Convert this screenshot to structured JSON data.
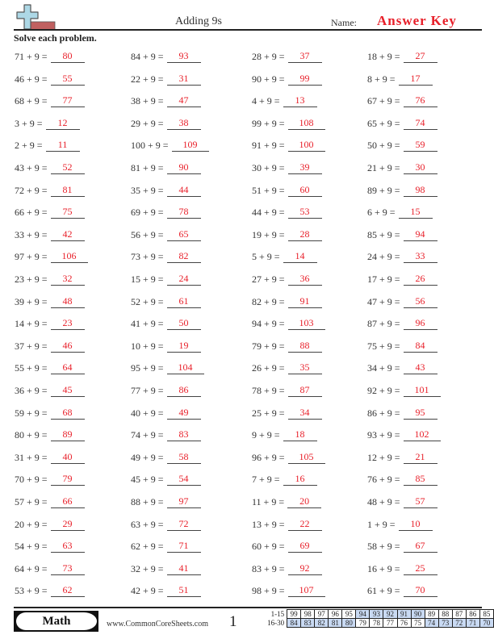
{
  "header": {
    "title": "Adding 9s",
    "name_label": "Name:",
    "name_value": "Answer Key"
  },
  "instructions": "Solve each problem.",
  "colors": {
    "answer": "#e8202a",
    "score_highlight": "#c9daf3",
    "logo_plus": "#add8e6",
    "logo_bar": "#c06060"
  },
  "columns": [
    [
      {
        "q": "71 + 9 =",
        "a": "80"
      },
      {
        "q": "46 + 9 =",
        "a": "55"
      },
      {
        "q": "68 + 9 =",
        "a": "77"
      },
      {
        "q": "3 + 9 =",
        "a": "12"
      },
      {
        "q": "2 + 9 =",
        "a": "11"
      },
      {
        "q": "43 + 9 =",
        "a": "52"
      },
      {
        "q": "72 + 9 =",
        "a": "81"
      },
      {
        "q": "66 + 9 =",
        "a": "75"
      },
      {
        "q": "33 + 9 =",
        "a": "42"
      },
      {
        "q": "97 + 9 =",
        "a": "106"
      },
      {
        "q": "23 + 9 =",
        "a": "32"
      },
      {
        "q": "39 + 9 =",
        "a": "48"
      },
      {
        "q": "14 + 9 =",
        "a": "23"
      },
      {
        "q": "37 + 9 =",
        "a": "46"
      },
      {
        "q": "55 + 9 =",
        "a": "64"
      },
      {
        "q": "36 + 9 =",
        "a": "45"
      },
      {
        "q": "59 + 9 =",
        "a": "68"
      },
      {
        "q": "80 + 9 =",
        "a": "89"
      },
      {
        "q": "31 + 9 =",
        "a": "40"
      },
      {
        "q": "70 + 9 =",
        "a": "79"
      },
      {
        "q": "57 + 9 =",
        "a": "66"
      },
      {
        "q": "20 + 9 =",
        "a": "29"
      },
      {
        "q": "54 + 9 =",
        "a": "63"
      },
      {
        "q": "64 + 9 =",
        "a": "73"
      },
      {
        "q": "53 + 9 =",
        "a": "62"
      }
    ],
    [
      {
        "q": "84 + 9 =",
        "a": "93"
      },
      {
        "q": "22 + 9 =",
        "a": "31"
      },
      {
        "q": "38 + 9 =",
        "a": "47"
      },
      {
        "q": "29 + 9 =",
        "a": "38"
      },
      {
        "q": "100 + 9 =",
        "a": "109"
      },
      {
        "q": "81 + 9 =",
        "a": "90"
      },
      {
        "q": "35 + 9 =",
        "a": "44"
      },
      {
        "q": "69 + 9 =",
        "a": "78"
      },
      {
        "q": "56 + 9 =",
        "a": "65"
      },
      {
        "q": "73 + 9 =",
        "a": "82"
      },
      {
        "q": "15 + 9 =",
        "a": "24"
      },
      {
        "q": "52 + 9 =",
        "a": "61"
      },
      {
        "q": "41 + 9 =",
        "a": "50"
      },
      {
        "q": "10 + 9 =",
        "a": "19"
      },
      {
        "q": "95 + 9 =",
        "a": "104"
      },
      {
        "q": "77 + 9 =",
        "a": "86"
      },
      {
        "q": "40 + 9 =",
        "a": "49"
      },
      {
        "q": "74 + 9 =",
        "a": "83"
      },
      {
        "q": "49 + 9 =",
        "a": "58"
      },
      {
        "q": "45 + 9 =",
        "a": "54"
      },
      {
        "q": "88 + 9 =",
        "a": "97"
      },
      {
        "q": "63 + 9 =",
        "a": "72"
      },
      {
        "q": "62 + 9 =",
        "a": "71"
      },
      {
        "q": "32 + 9 =",
        "a": "41"
      },
      {
        "q": "42 + 9 =",
        "a": "51"
      }
    ],
    [
      {
        "q": "28 + 9 =",
        "a": "37"
      },
      {
        "q": "90 + 9 =",
        "a": "99"
      },
      {
        "q": "4 + 9 =",
        "a": "13"
      },
      {
        "q": "99 + 9 =",
        "a": "108"
      },
      {
        "q": "91 + 9 =",
        "a": "100"
      },
      {
        "q": "30 + 9 =",
        "a": "39"
      },
      {
        "q": "51 + 9 =",
        "a": "60"
      },
      {
        "q": "44 + 9 =",
        "a": "53"
      },
      {
        "q": "19 + 9 =",
        "a": "28"
      },
      {
        "q": "5 + 9 =",
        "a": "14"
      },
      {
        "q": "27 + 9 =",
        "a": "36"
      },
      {
        "q": "82 + 9 =",
        "a": "91"
      },
      {
        "q": "94 + 9 =",
        "a": "103"
      },
      {
        "q": "79 + 9 =",
        "a": "88"
      },
      {
        "q": "26 + 9 =",
        "a": "35"
      },
      {
        "q": "78 + 9 =",
        "a": "87"
      },
      {
        "q": "25 + 9 =",
        "a": "34"
      },
      {
        "q": "9 + 9 =",
        "a": "18"
      },
      {
        "q": "96 + 9 =",
        "a": "105"
      },
      {
        "q": "7 + 9 =",
        "a": "16"
      },
      {
        "q": "11 + 9 =",
        "a": "20"
      },
      {
        "q": "13 + 9 =",
        "a": "22"
      },
      {
        "q": "60 + 9 =",
        "a": "69"
      },
      {
        "q": "83 + 9 =",
        "a": "92"
      },
      {
        "q": "98 + 9 =",
        "a": "107"
      }
    ],
    [
      {
        "q": "18 + 9 =",
        "a": "27"
      },
      {
        "q": "8 + 9 =",
        "a": "17"
      },
      {
        "q": "67 + 9 =",
        "a": "76"
      },
      {
        "q": "65 + 9 =",
        "a": "74"
      },
      {
        "q": "50 + 9 =",
        "a": "59"
      },
      {
        "q": "21 + 9 =",
        "a": "30"
      },
      {
        "q": "89 + 9 =",
        "a": "98"
      },
      {
        "q": "6 + 9 =",
        "a": "15"
      },
      {
        "q": "85 + 9 =",
        "a": "94"
      },
      {
        "q": "24 + 9 =",
        "a": "33"
      },
      {
        "q": "17 + 9 =",
        "a": "26"
      },
      {
        "q": "47 + 9 =",
        "a": "56"
      },
      {
        "q": "87 + 9 =",
        "a": "96"
      },
      {
        "q": "75 + 9 =",
        "a": "84"
      },
      {
        "q": "34 + 9 =",
        "a": "43"
      },
      {
        "q": "92 + 9 =",
        "a": "101"
      },
      {
        "q": "86 + 9 =",
        "a": "95"
      },
      {
        "q": "93 + 9 =",
        "a": "102"
      },
      {
        "q": "12 + 9 =",
        "a": "21"
      },
      {
        "q": "76 + 9 =",
        "a": "85"
      },
      {
        "q": "48 + 9 =",
        "a": "57"
      },
      {
        "q": "1 + 9 =",
        "a": "10"
      },
      {
        "q": "58 + 9 =",
        "a": "67"
      },
      {
        "q": "16 + 9 =",
        "a": "25"
      },
      {
        "q": "61 + 9 =",
        "a": "70"
      }
    ]
  ],
  "footer": {
    "subject": "Math",
    "url": "www.CommonCoreSheets.com",
    "page": "1",
    "score_rows": [
      {
        "label": "1-15",
        "values": [
          "99",
          "98",
          "97",
          "96",
          "95",
          "94",
          "93",
          "92",
          "91",
          "90",
          "89",
          "88",
          "87",
          "86",
          "85"
        ],
        "highlight": [
          false,
          false,
          false,
          false,
          false,
          true,
          true,
          true,
          true,
          true,
          false,
          false,
          false,
          false,
          false
        ]
      },
      {
        "label": "16-30",
        "values": [
          "84",
          "83",
          "82",
          "81",
          "80",
          "79",
          "78",
          "77",
          "76",
          "75",
          "74",
          "73",
          "72",
          "71",
          "70"
        ],
        "highlight": [
          true,
          true,
          true,
          true,
          true,
          false,
          false,
          false,
          false,
          false,
          true,
          true,
          true,
          true,
          true
        ]
      }
    ]
  }
}
